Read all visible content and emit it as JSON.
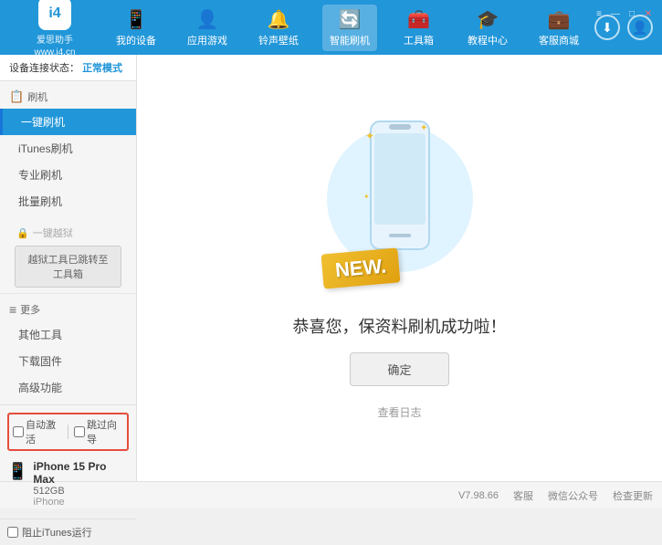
{
  "header": {
    "logo": {
      "icon_text": "i4",
      "brand_name": "爱思助手",
      "website": "www.i4.cn"
    },
    "nav": [
      {
        "id": "my-device",
        "label": "我的设备",
        "icon": "📱"
      },
      {
        "id": "apps-games",
        "label": "应用游戏",
        "icon": "👤"
      },
      {
        "id": "ringtone",
        "label": "铃声壁纸",
        "icon": "🔔"
      },
      {
        "id": "smart-flash",
        "label": "智能刷机",
        "icon": "🔄",
        "active": true
      },
      {
        "id": "toolbox",
        "label": "工具箱",
        "icon": "🧰"
      },
      {
        "id": "tutorial",
        "label": "教程中心",
        "icon": "🎓"
      },
      {
        "id": "service",
        "label": "客服商城",
        "icon": "💼"
      }
    ],
    "right": {
      "download_icon": "⬇",
      "user_icon": "👤"
    },
    "win_controls": {
      "wifi": "≡",
      "minimize": "—",
      "maximize": "□",
      "close": "✕"
    }
  },
  "sidebar": {
    "status_label": "设备连接状态：",
    "status_value": "正常模式",
    "sections": [
      {
        "id": "flash",
        "icon": "📋",
        "label": "刷机",
        "items": [
          {
            "id": "one-click-flash",
            "label": "一键刷机",
            "active": true
          },
          {
            "id": "itunes-flash",
            "label": "iTunes刷机"
          },
          {
            "id": "pro-flash",
            "label": "专业刷机"
          },
          {
            "id": "batch-flash",
            "label": "批量刷机"
          }
        ]
      }
    ],
    "disabled_section": {
      "icon": "🔒",
      "label": "一键越狱",
      "message": "越狱工具已跳转至\n工具箱"
    },
    "more_section": {
      "icon": "≡",
      "label": "更多",
      "items": [
        {
          "id": "other-tools",
          "label": "其他工具"
        },
        {
          "id": "download-firmware",
          "label": "下载固件"
        },
        {
          "id": "advanced",
          "label": "高级功能"
        }
      ]
    },
    "bottom": {
      "auto_activate": "自动激活",
      "guide_activate": "跳过向导",
      "device": {
        "icon": "📱",
        "name": "iPhone 15 Pro Max",
        "storage": "512GB",
        "type": "iPhone"
      }
    },
    "footer": {
      "itunes_label": "阻止iTunes运行"
    }
  },
  "content": {
    "success_message": "恭喜您，保资料刷机成功啦！",
    "confirm_button": "确定",
    "log_link": "查看日志",
    "illustration": {
      "new_text": "NEW."
    }
  },
  "footer": {
    "version": "V7.98.66",
    "links": [
      {
        "id": "home",
        "label": "客服"
      },
      {
        "id": "wechat",
        "label": "微信公众号"
      },
      {
        "id": "check-update",
        "label": "检查更新"
      }
    ]
  }
}
